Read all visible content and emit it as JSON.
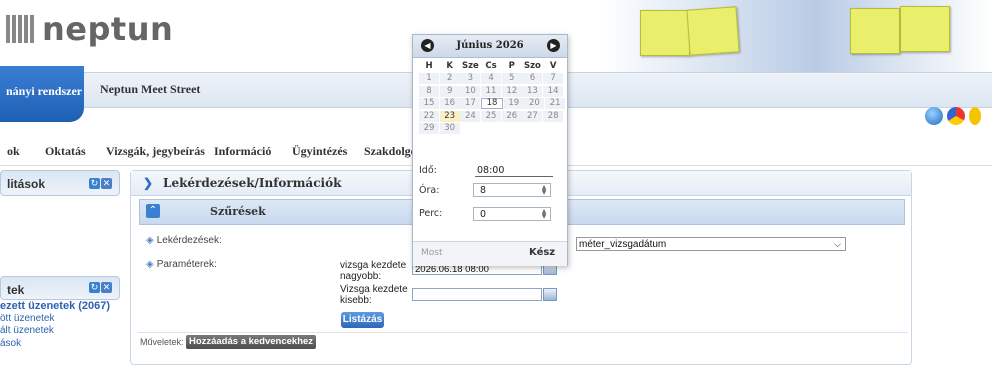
{
  "header": {
    "logo_text": "neptun",
    "system_tab": "nányi rendszer",
    "meet_tab": "Neptun Meet Street"
  },
  "menu": {
    "items": [
      "ok",
      "Oktatás",
      "Vizsgák, jegybeírás",
      "Információ",
      "Ügyintézés",
      "Szakdolgo"
    ]
  },
  "left": {
    "panel1_title": "litások",
    "panel2_title": "tek",
    "links": [
      "ezett üzenetek (2067)",
      "ött üzenetek",
      "ált üzenetek",
      "ások"
    ]
  },
  "main": {
    "title": "Lekérdezések/Információk",
    "filter_title": "Szűrések",
    "queries_label": "Lekérdezések:",
    "params_label": "Paraméterek:",
    "exam_start_greater_label": "vizsga kezdete nagyobb:",
    "exam_start_greater_value": "2026.06.18 08:00",
    "exam_start_less_label": "Vizsga kezdete kisebb:",
    "exam_start_less_value": "",
    "query_select_value": "méter_vizsgadátum",
    "list_button": "Listázás",
    "operations_label": "Műveletek:",
    "favorite_button": "Hozzáadás a kedvencekhez"
  },
  "calendar": {
    "title": "Június 2026",
    "prev": "◀",
    "next": "▶",
    "weekdays": [
      "H",
      "K",
      "Sze",
      "Cs",
      "P",
      "Szo",
      "V"
    ],
    "weeks": [
      [
        "1",
        "2",
        "3",
        "4",
        "5",
        "6",
        "7"
      ],
      [
        "8",
        "9",
        "10",
        "11",
        "12",
        "13",
        "14"
      ],
      [
        "15",
        "16",
        "17",
        "18",
        "19",
        "20",
        "21"
      ],
      [
        "22",
        "23",
        "24",
        "25",
        "26",
        "27",
        "28"
      ],
      [
        "29",
        "30",
        "",
        "",
        "",
        "",
        ""
      ]
    ],
    "selected_day": "18",
    "today_day": "23",
    "time_label": "Idő:",
    "time_value": "08:00",
    "hour_label": "Óra:",
    "hour_value": "8",
    "minute_label": "Perc:",
    "minute_value": "0",
    "now_button": "Most",
    "done_button": "Kész"
  }
}
